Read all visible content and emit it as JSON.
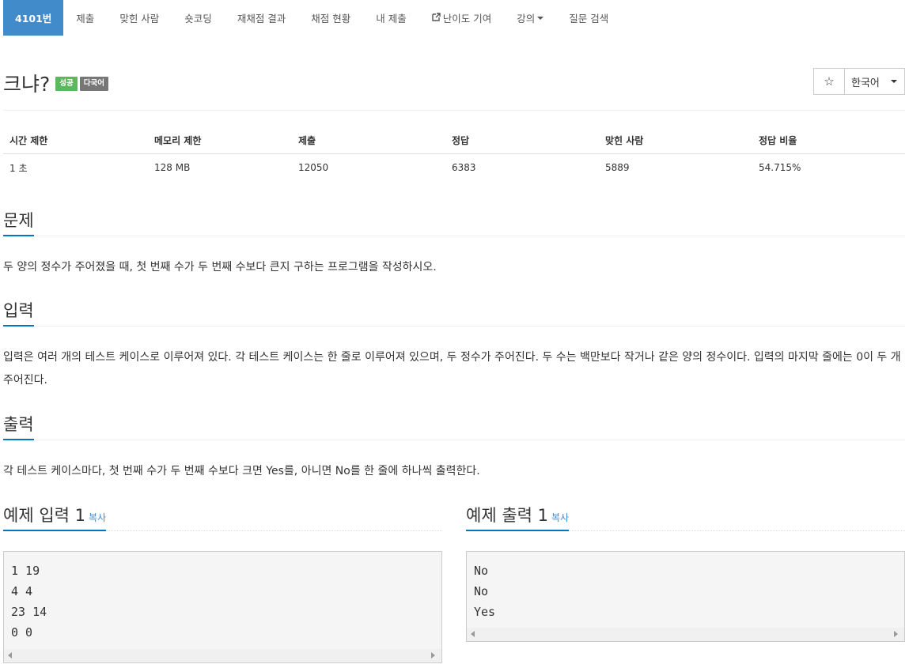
{
  "nav": {
    "items": [
      {
        "label": "4101번"
      },
      {
        "label": "제출"
      },
      {
        "label": "맞힌 사람"
      },
      {
        "label": "숏코딩"
      },
      {
        "label": "재채점 결과"
      },
      {
        "label": "채점 현황"
      },
      {
        "label": "내 제출"
      },
      {
        "label": "난이도 기여",
        "icon": "external-link-icon"
      },
      {
        "label": "강의",
        "icon": "caret-down-icon"
      },
      {
        "label": "질문 검색"
      }
    ]
  },
  "problem": {
    "title": "크냐?",
    "badge_success": "성공",
    "badge_multi": "다국어",
    "star_icon": "☆",
    "language": "한국어"
  },
  "stats": {
    "headers": [
      "시간 제한",
      "메모리 제한",
      "제출",
      "정답",
      "맞힌 사람",
      "정답 비율"
    ],
    "values": [
      "1 초",
      "128 MB",
      "12050",
      "6383",
      "5889",
      "54.715%"
    ]
  },
  "sections": {
    "problem_heading": "문제",
    "problem_text": "두 양의 정수가 주어졌을 때, 첫 번째 수가 두 번째 수보다 큰지 구하는 프로그램을 작성하시오.",
    "input_heading": "입력",
    "input_text": "입력은 여러 개의 테스트 케이스로 이루어져 있다. 각 테스트 케이스는 한 줄로 이루어져 있으며, 두 정수가 주어진다. 두 수는 백만보다 작거나 같은 양의 정수이다. 입력의 마지막 줄에는 0이 두 개 주어진다.",
    "output_heading": "출력",
    "output_text": "각 테스트 케이스마다, 첫 번째 수가 두 번째 수보다 크면 Yes를, 아니면 No를 한 줄에 하나씩 출력한다."
  },
  "examples": {
    "input_heading": "예제 입력 1",
    "output_heading": "예제 출력 1",
    "copy_label": "복사",
    "input_lines": "1 19\n4 4\n23 14\n0 0",
    "output_lines": "No\nNo\nYes"
  },
  "colors": {
    "accent": "#428bca",
    "underline": "#0076c0",
    "success": "#5cb85c",
    "muted": "#777777"
  }
}
